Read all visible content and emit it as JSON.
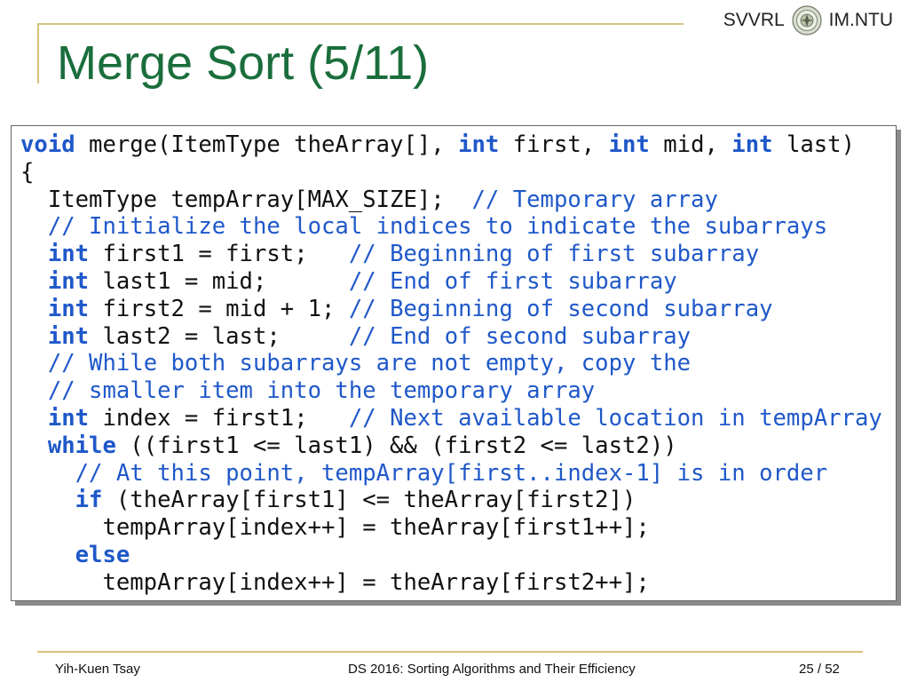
{
  "header": {
    "lab": "SVVRL",
    "school": "IM.NTU",
    "seal_icon": "ntu-seal-icon"
  },
  "slide": {
    "title": "Merge Sort (5/11)"
  },
  "code": {
    "lines": [
      [
        {
          "t": "void",
          "c": "kw"
        },
        {
          "t": " merge(ItemType theArray[], "
        },
        {
          "t": "int",
          "c": "kw"
        },
        {
          "t": " first, "
        },
        {
          "t": "int",
          "c": "kw"
        },
        {
          "t": " mid, "
        },
        {
          "t": "int",
          "c": "kw"
        },
        {
          "t": " last)"
        }
      ],
      [
        {
          "t": "{"
        }
      ],
      [
        {
          "t": "  ItemType tempArray[MAX_SIZE];  "
        },
        {
          "t": "// Temporary array",
          "c": "cm"
        }
      ],
      [
        {
          "t": "  "
        },
        {
          "t": "// Initialize the local indices to indicate the subarrays",
          "c": "cm"
        }
      ],
      [
        {
          "t": "  "
        },
        {
          "t": "int",
          "c": "kw"
        },
        {
          "t": " first1 = first;   "
        },
        {
          "t": "// Beginning of first subarray",
          "c": "cm"
        }
      ],
      [
        {
          "t": "  "
        },
        {
          "t": "int",
          "c": "kw"
        },
        {
          "t": " last1 = mid;      "
        },
        {
          "t": "// End of first subarray",
          "c": "cm"
        }
      ],
      [
        {
          "t": "  "
        },
        {
          "t": "int",
          "c": "kw"
        },
        {
          "t": " first2 = mid + 1; "
        },
        {
          "t": "// Beginning of second subarray",
          "c": "cm"
        }
      ],
      [
        {
          "t": "  "
        },
        {
          "t": "int",
          "c": "kw"
        },
        {
          "t": " last2 = last;     "
        },
        {
          "t": "// End of second subarray",
          "c": "cm"
        }
      ],
      [
        {
          "t": "  "
        },
        {
          "t": "// While both subarrays are not empty, copy the",
          "c": "cm"
        }
      ],
      [
        {
          "t": "  "
        },
        {
          "t": "// smaller item into the temporary array",
          "c": "cm"
        }
      ],
      [
        {
          "t": "  "
        },
        {
          "t": "int",
          "c": "kw"
        },
        {
          "t": " index = first1;   "
        },
        {
          "t": "// Next available location in tempArray",
          "c": "cm"
        }
      ],
      [
        {
          "t": "  "
        },
        {
          "t": "while",
          "c": "kw"
        },
        {
          "t": " ((first1 <= last1) && (first2 <= last2))"
        }
      ],
      [
        {
          "t": "    "
        },
        {
          "t": "// At this point, tempArray[first..index-1] is in order",
          "c": "cm"
        }
      ],
      [
        {
          "t": "    "
        },
        {
          "t": "if",
          "c": "kw"
        },
        {
          "t": " (theArray[first1] <= theArray[first2])"
        }
      ],
      [
        {
          "t": "      tempArray[index++] = theArray[first1++];"
        }
      ],
      [
        {
          "t": "    "
        },
        {
          "t": "else",
          "c": "kw"
        }
      ],
      [
        {
          "t": "      tempArray[index++] = theArray[first2++];"
        }
      ]
    ]
  },
  "footer": {
    "author": "Yih-Kuen Tsay",
    "course": "DS 2016: Sorting Algorithms and Their Efficiency",
    "page_current": "25",
    "page_separator": "/",
    "page_total": "52"
  }
}
